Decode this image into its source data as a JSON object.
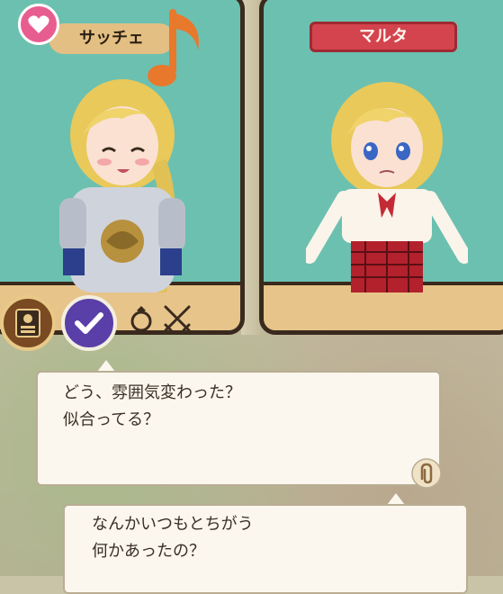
{
  "characters": {
    "left": {
      "name": "サッチェ"
    },
    "right": {
      "name": "マルタ"
    }
  },
  "dialog": {
    "box1": {
      "lines": [
        "どう、雰囲気変わった？",
        "似合ってる？"
      ]
    },
    "box2": {
      "lines": [
        "なんかいつもとちがう",
        "何かあったの？"
      ]
    }
  },
  "icons": {
    "heart": "heart-icon",
    "music_note": "music-note-icon",
    "profile_card": "profile-card-icon",
    "check": "check-icon",
    "ring": "ring-icon",
    "swords": "crossed-swords-icon",
    "paperclip": "paperclip-icon"
  },
  "colors": {
    "panel_bg": "#6cc0b0",
    "panel_border": "#3a2a1e",
    "nameplate_left": "#e3bf83",
    "nameplate_right": "#d4444e",
    "heart": "#e85d8f",
    "check_button": "#5a3fa8"
  }
}
